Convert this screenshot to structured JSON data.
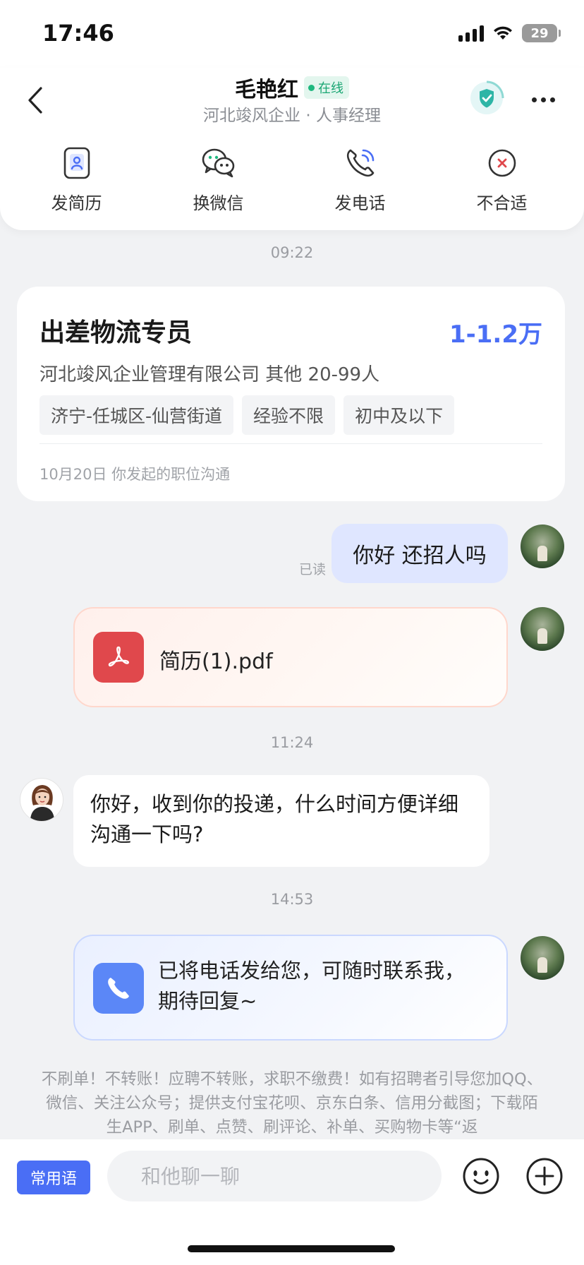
{
  "status_bar": {
    "time": "17:46",
    "battery": "29"
  },
  "header": {
    "contact_name": "毛艳红",
    "online_label": "在线",
    "subtitle": "河北竣风企业 · 人事经理",
    "actions": [
      {
        "label": "发简历",
        "icon": "resume-icon"
      },
      {
        "label": "换微信",
        "icon": "wechat-icon"
      },
      {
        "label": "发电话",
        "icon": "phone-icon"
      },
      {
        "label": "不合适",
        "icon": "close-circle-icon"
      }
    ]
  },
  "chat": {
    "timestamps": [
      "09:22",
      "11:24",
      "14:53"
    ],
    "job_card": {
      "title": "出差物流专员",
      "salary": "1-1.2万",
      "company": "河北竣风企业管理有限公司 其他 20-99人",
      "tags": [
        "济宁-任城区-仙营街道",
        "经验不限",
        "初中及以下"
      ],
      "footer": "10月20日 你发起的职位沟通"
    },
    "my_message": "你好 还招人吗",
    "read_mark": "已读",
    "file_name": "简历(1).pdf",
    "hr_message": "你好，收到你的投递，什么时间方便详细沟通一下吗?",
    "phone_message": "已将电话发给您，可随时联系我，期待回复~",
    "warning": "不刷单！不转账！应聘不转账，求职不缴费！如有招聘者引导您加QQ、微信、关注公众号；提供支付宝花呗、京东白条、信用分截图；下载陌生APP、刷单、点赞、刷评论、补单、买购物卡等“返"
  },
  "bottom_bar": {
    "phrases_label": "常用语",
    "input_placeholder": "和他聊一聊"
  },
  "colors": {
    "accent": "#4a6ef5",
    "online": "#1fb87f",
    "pdf": "#e0484c",
    "phone": "#5b87f7"
  }
}
